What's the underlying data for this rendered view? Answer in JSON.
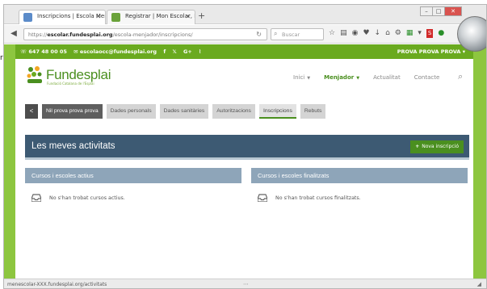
{
  "browser": {
    "tabs": [
      {
        "label": "Inscripcions | Escola Menja..."
      },
      {
        "label": "Registrar | Mon Escolar, Esc..."
      }
    ],
    "new_tab": "+",
    "url_host": "escolar.fundesplai.org",
    "url_path": "/escola-menjador/inscripcions/",
    "url_prefix": "https://",
    "search_placeholder": "Buscar",
    "status_url": "menescolar-XXX.fundesplai.org/activitats"
  },
  "site": {
    "phone": "647 48 00 05",
    "email": "escolaocc@fundesplai.org",
    "social": [
      "f",
      "𝕏",
      "G+",
      "⌇"
    ],
    "school_selector": "PROVA PROVA PROVA",
    "logo_name": "Fundesplai",
    "logo_tagline": "Fundació Catalana de l'Esplai",
    "menu": [
      {
        "label": "Inici",
        "chevron": true
      },
      {
        "label": "Menjador",
        "chevron": true
      },
      {
        "label": "Actualitat",
        "chevron": false
      },
      {
        "label": "Contacte",
        "chevron": false
      }
    ]
  },
  "student_tabs": {
    "back": "<",
    "child": "Nil prova prova prova",
    "items": [
      "Dades personals",
      "Dades sanitàries",
      "Autoritzacions",
      "Inscripcions",
      "Rebuts"
    ]
  },
  "activities": {
    "title": "Les meves activitats",
    "new_button": "Nova inscripció",
    "active_header": "Cursos i escoles actius",
    "active_empty": "No s'han trobat cursos actius.",
    "finished_header": "Cursos i escoles finalitzats",
    "finished_empty": "No s'han trobat cursos finalitzats."
  },
  "colors": {
    "brand_green": "#8dc63f",
    "dark_green": "#4a8f1f",
    "header_blue": "#3d5a73",
    "panel_blue": "#8ea5b9"
  }
}
